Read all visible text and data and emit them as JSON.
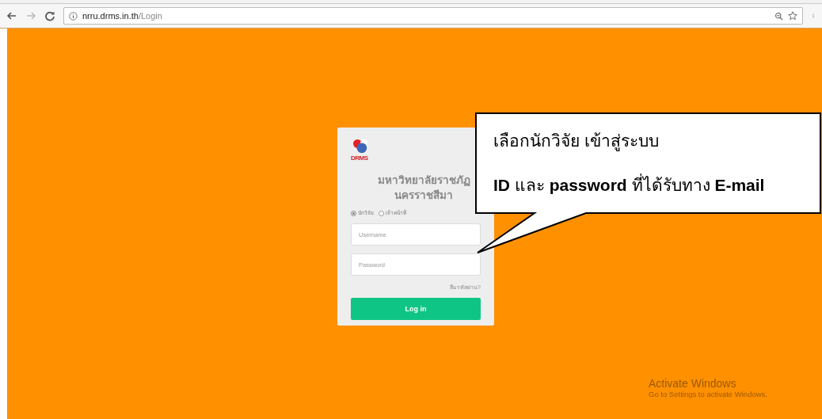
{
  "browser": {
    "url_host": "nrru.drms.in.th",
    "url_path": "/Login"
  },
  "login": {
    "logo_text": "DRMS",
    "title": "มหาวิทยาลัยราชภัฏ นครราชสีมา",
    "roles": [
      {
        "label": "นักวิจัย",
        "selected": true
      },
      {
        "label": "เจ้าหน้าที่",
        "selected": false
      }
    ],
    "username": {
      "placeholder": "Username"
    },
    "password": {
      "placeholder": "Password"
    },
    "forgot_link": "ลืมรหัสผ่าน?",
    "submit": "Log in"
  },
  "callout": {
    "lines": [
      "เลือกนักวิจัย เข้าสู่ระบบ",
      "**ID** และ **password** ที่ได้รับทาง **E-mail**"
    ]
  },
  "activation_notice": {
    "title": "Activate Windows",
    "subtitle": "Go to Settings to activate Windows."
  }
}
